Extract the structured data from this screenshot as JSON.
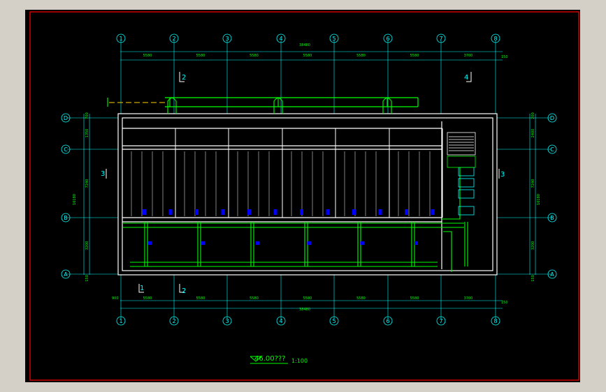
{
  "colors": {
    "frame": "#ff0000",
    "wall": "#ffffff",
    "grid": "#00ffff",
    "pipe": "#00ff00",
    "label": "#00ff00",
    "valve": "#0000ff",
    "dash": "#ffd400"
  },
  "grid_columns": [
    "1",
    "2",
    "3",
    "4",
    "5",
    "6",
    "7",
    "8"
  ],
  "grid_rows": [
    "D",
    "C",
    "B",
    "A"
  ],
  "dimensions": {
    "top_total": "38480",
    "bottom_total": "38480",
    "top_spans": [
      "5580",
      "5580",
      "5580",
      "5580",
      "5580",
      "5580",
      "3700"
    ],
    "bottom_spans": [
      "5580",
      "5580",
      "5580",
      "5580",
      "5580",
      "5580",
      "3700"
    ],
    "left_total": "16180",
    "right_total": "16180",
    "top_edge": "150",
    "bottom_edge": "150",
    "bottom_left_edge": "900",
    "right_spans": [
      "200",
      "2400",
      "7240",
      "3200",
      "150"
    ],
    "left_spans": [
      "700",
      "1350",
      "7240",
      "3200",
      "150"
    ]
  },
  "section_marks": {
    "top": [
      "2",
      "4"
    ],
    "bottom": [
      "1",
      "2"
    ],
    "side": [
      "3",
      "3"
    ]
  },
  "title": {
    "label": "46.00???",
    "scale": "1:100"
  }
}
